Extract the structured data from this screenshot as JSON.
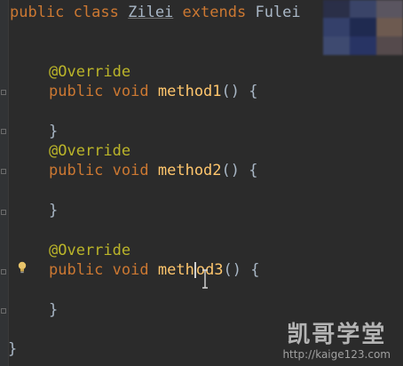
{
  "editor": {
    "lines": {
      "l1": {
        "kw1": "public",
        "kw2": "class",
        "cls": "Zilei",
        "kw3": "extends",
        "parent": "Fulei"
      },
      "ann1": "@Override",
      "m1": {
        "kw1": "public",
        "kw2": "void",
        "name": "method1",
        "tail": "() {"
      },
      "close1": "}",
      "ann2": "@Override",
      "m2": {
        "kw1": "public",
        "kw2": "void",
        "name": "method2",
        "tail": "() {"
      },
      "close2": "}",
      "ann3": "@Override",
      "m3": {
        "kw1": "public",
        "kw2": "void",
        "name_a": "meth",
        "name_b": "od3",
        "tail": "() {"
      },
      "close3": "}",
      "close_class": "}"
    }
  },
  "watermark": {
    "title": "凯哥学堂",
    "url": "http://kaige123.com"
  },
  "colors": {
    "background": "#2b2b2b",
    "keyword": "#cc7832",
    "annotation": "#bbb529",
    "method": "#ffc66d",
    "text": "#a9b7c6"
  }
}
